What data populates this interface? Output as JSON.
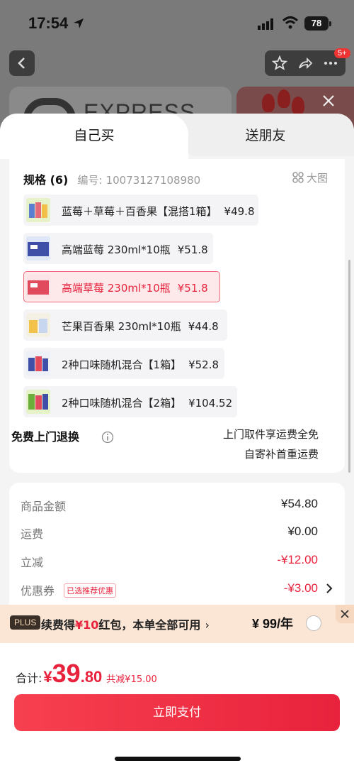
{
  "status": {
    "time": "17:54",
    "battery": "78"
  },
  "header": {
    "badge": "5+"
  },
  "background": {
    "logo_text": "EXPRESS"
  },
  "tabs": {
    "self_buy": "自己买",
    "gift": "送朋友"
  },
  "spec": {
    "title": "规格 (6)",
    "code_label": "编号:",
    "code": "10073127108980",
    "big_image": "大图",
    "options": [
      {
        "name": "蓝莓＋草莓＋百香果【混搭1箱】",
        "price": "¥49.8",
        "selected": false
      },
      {
        "name": "高端蓝莓 230ml*10瓶",
        "price": "¥51.8",
        "selected": false
      },
      {
        "name": "高端草莓 230ml*10瓶",
        "price": "¥51.8",
        "selected": true
      },
      {
        "name": "芒果百香果 230ml*10瓶",
        "price": "¥44.8",
        "selected": false
      },
      {
        "name": "2种口味随机混合【1箱】",
        "price": "¥52.8",
        "selected": false
      },
      {
        "name": "2种口味随机混合【2箱】",
        "price": "¥104.52",
        "selected": false
      }
    ]
  },
  "free_return": {
    "label": "免费上门退换",
    "note1": "上门取件享运费全免",
    "note2": "自寄补首重运费"
  },
  "summary": {
    "goods_label": "商品金额",
    "goods_value": "¥54.80",
    "shipping_label": "运费",
    "shipping_value": "¥0.00",
    "discount_label": "立减",
    "discount_value": "-¥12.00",
    "coupon_label": "优惠券",
    "coupon_tag": "已选推荐优惠",
    "coupon_value": "-¥3.00"
  },
  "plus": {
    "badge": "PLUS",
    "text_prefix": "续费得",
    "text_highlight": "¥10",
    "text_suffix": "红包，本单全部可用",
    "arrow": "›",
    "price": "¥ 99/年"
  },
  "bottom": {
    "total_label": "合计:",
    "yen": "¥",
    "total_int": "39",
    "total_dec": ".80",
    "saved": "共减¥15.00",
    "pay_button": "立即支付"
  },
  "colors": {
    "accent": "#e8223c",
    "plus_bg": "#fbe6d5"
  }
}
